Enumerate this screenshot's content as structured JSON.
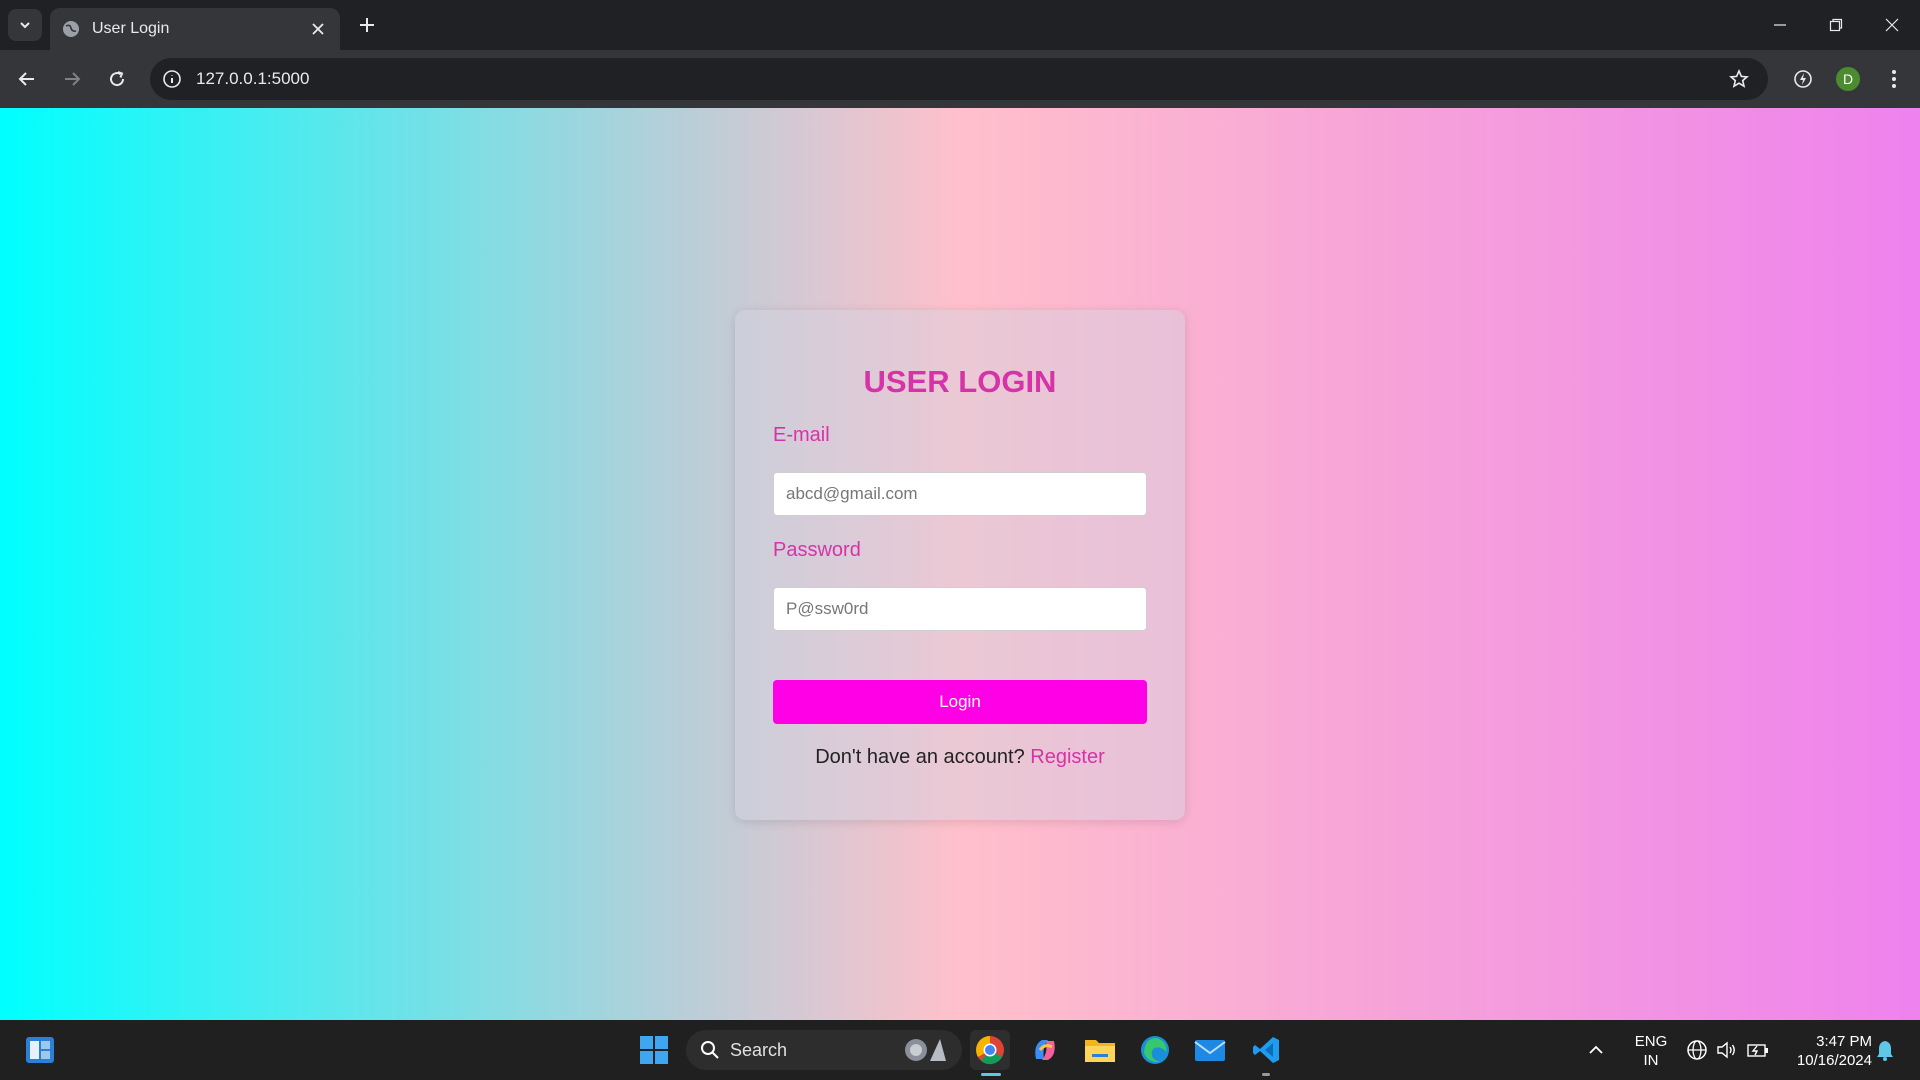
{
  "browser": {
    "tab_title": "User Login",
    "url": "127.0.0.1:5000",
    "profile_initial": "D"
  },
  "login": {
    "title": "USER LOGIN",
    "email_label": "E-mail",
    "email_placeholder": "abcd@gmail.com",
    "password_label": "Password",
    "password_placeholder": "P@ssw0rd",
    "login_button": "Login",
    "register_prompt": "Don't have an account?",
    "register_link": "Register"
  },
  "taskbar": {
    "search_label": "Search",
    "lang_line1": "ENG",
    "lang_line2": "IN",
    "time": "3:47 PM",
    "date": "10/16/2024"
  },
  "colors": {
    "accent_pink": "#d633a9",
    "button_magenta": "#ff00e6",
    "gradient_start": "#00ffff",
    "gradient_mid": "#ffc0cb",
    "gradient_end": "#ee82ee"
  }
}
